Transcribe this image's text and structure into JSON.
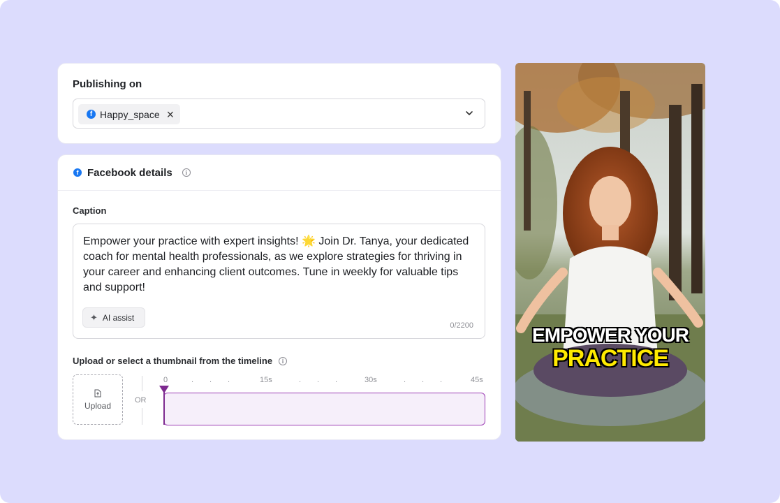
{
  "publishing": {
    "title": "Publishing on",
    "selected_account": "Happy_space",
    "account_icon": "facebook-icon"
  },
  "details": {
    "title": "Facebook details",
    "caption_label": "Caption",
    "caption_text": "Empower your practice with expert insights! 🌟 Join Dr. Tanya, your dedicated coach for mental health professionals, as we explore strategies for thriving in your career and enhancing client outcomes. Tune in weekly for valuable tips and support!",
    "ai_assist_label": "AI assist",
    "char_count": "0/2200",
    "thumbnail_label": "Upload or select a thumbnail from the timeline",
    "upload_label": "Upload",
    "or_label": "OR",
    "timeline_ticks": [
      "0",
      "15s",
      "30s",
      "45s"
    ]
  },
  "preview": {
    "overlay_line1": "EMPOWER YOUR",
    "overlay_line2": "PRACTICE"
  },
  "colors": {
    "background": "#dcdcfd",
    "facebook_blue": "#1877f2",
    "timeline_accent": "#9b3bb4",
    "overlay_yellow": "#ffea00"
  }
}
